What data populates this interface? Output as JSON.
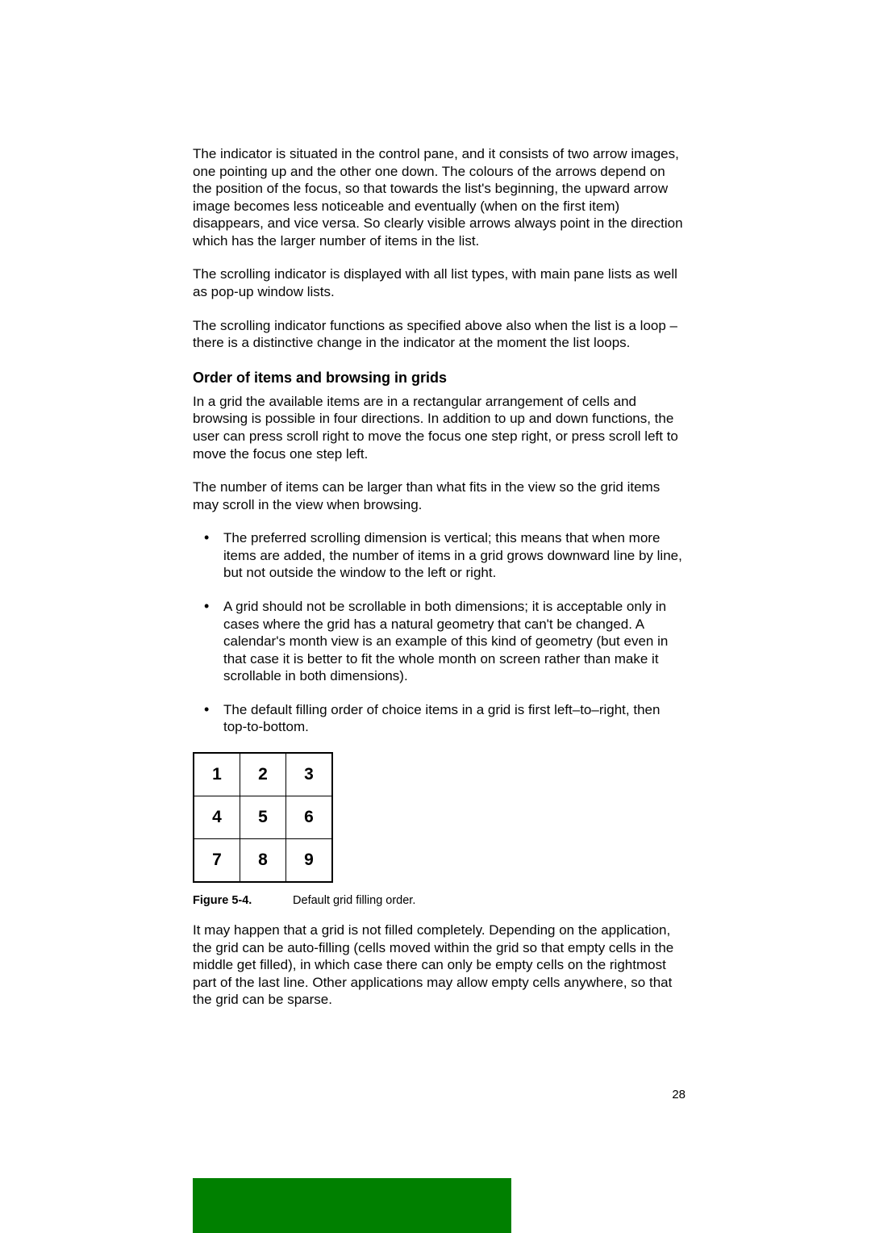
{
  "paragraphs": {
    "p1": "The indicator is situated in the control pane, and it consists of two arrow images, one pointing up and the other one down. The colours of the arrows depend on the position of the focus, so that towards the list's beginning, the upward arrow image becomes less noticeable and eventually (when on the first item) disappears, and vice versa.  So clearly visible arrows always point in the direction which has the larger number of items in the list.",
    "p2": "The scrolling indicator is displayed with all list types, with main pane lists as well as pop-up window lists.",
    "p3": "The scrolling indicator functions as specified above also when the list is a loop – there is a distinctive change in the indicator at the moment the list loops.",
    "p4": "In a grid the available items are in a rectangular arrangement of cells and browsing is possible in four directions. In addition to up and down functions, the user can press scroll right to move the focus one step right, or press scroll left to move the focus one step left.",
    "p5": "The number of items can be larger than what fits in the view so the grid items may scroll in the view when browsing.",
    "p6": "It may happen that a grid is not filled completely. Depending on the application, the grid can be auto-filling (cells moved within the grid so that empty cells in the middle get filled), in which case there can only be empty cells on the rightmost part of the last line. Other applications may allow empty cells anywhere, so that the grid can be sparse."
  },
  "heading": "Order of items and browsing in grids",
  "bullets": [
    "The preferred scrolling dimension is vertical; this means that when more items are added, the number of items in a grid grows downward line by line, but not outside the window to the left or right.",
    "A grid should not be scrollable in both dimensions; it is acceptable only in cases where the grid has a natural geometry that can't be changed. A calendar's month view is an example of this kind of geometry (but even in that case it is better to fit the whole month on screen rather than make it scrollable in both dimensions).",
    "The default filling order of choice items in a grid is first left–to–right, then top-to-bottom."
  ],
  "grid": [
    [
      "1",
      "2",
      "3"
    ],
    [
      "4",
      "5",
      "6"
    ],
    [
      "7",
      "8",
      "9"
    ]
  ],
  "figure": {
    "label": "Figure 5-4.",
    "caption": "Default grid filling order."
  },
  "page_number": "28",
  "colors": {
    "green_bar": "#008000"
  }
}
